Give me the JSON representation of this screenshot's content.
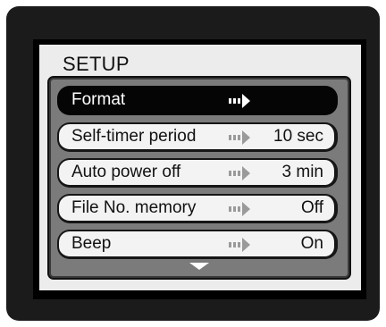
{
  "screen": {
    "title": "SETUP"
  },
  "menu": {
    "items": [
      {
        "label": "Format",
        "value": "",
        "selected": true
      },
      {
        "label": "Self-timer period",
        "value": "10 sec",
        "selected": false
      },
      {
        "label": "Auto power off",
        "value": "3 min",
        "selected": false
      },
      {
        "label": "File No. memory",
        "value": "Off",
        "selected": false
      },
      {
        "label": "Beep",
        "value": "On",
        "selected": false
      }
    ],
    "scroll_indicator": "down-triangle-icon"
  },
  "colors": {
    "selected_bg": "#050505",
    "item_bg": "#f3f3f3",
    "frame_bg": "#7b7b7b",
    "arrow_selected": "#ffffff",
    "arrow_normal": "#9a9a9a"
  }
}
